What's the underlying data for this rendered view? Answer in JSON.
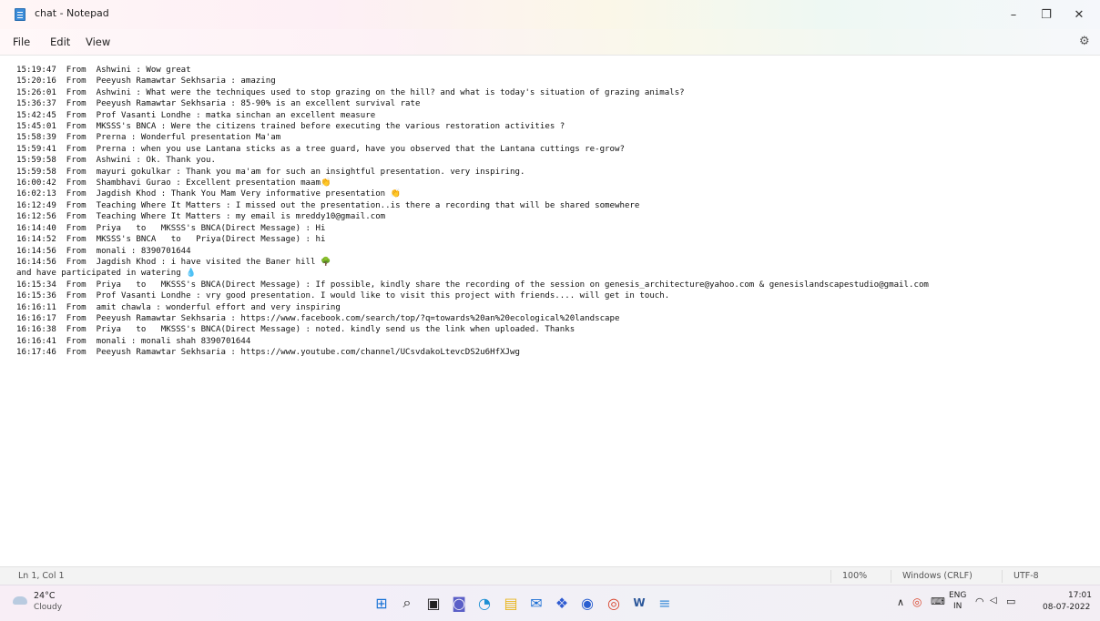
{
  "window": {
    "title": "chat - Notepad",
    "minimize_glyph": "–",
    "maximize_glyph": "❐",
    "close_glyph": "✕"
  },
  "menu": {
    "items": [
      "File",
      "Edit",
      "View"
    ],
    "settings_glyph": "⚙"
  },
  "document": {
    "lines": [
      "15:19:47\tFrom  Ashwini : Wow great",
      "15:20:16\tFrom  Peeyush Ramawtar Sekhsaria : amazing",
      "15:26:01\tFrom  Ashwini : What were the techniques used to stop grazing on the hill? and what is today's situation of grazing animals?",
      "15:36:37\tFrom  Peeyush Ramawtar Sekhsaria : 85-90% is an excellent survival rate",
      "15:42:45\tFrom  Prof Vasanti Londhe : matka sinchan an excellent measure",
      "15:45:01\tFrom  MKSSS's BNCA : Were the citizens trained before executing the various restoration activities ?",
      "15:58:39\tFrom  Prerna : Wonderful presentation Ma'am",
      "15:59:41\tFrom  Prerna : when you use Lantana sticks as a tree guard, have you observed that the Lantana cuttings re-grow?",
      "15:59:58\tFrom  Ashwini : Ok. Thank you.",
      "15:59:58\tFrom  mayuri gokulkar : Thank you ma'am for such an insightful presentation. very inspiring.",
      "16:00:42\tFrom  Shambhavi Gurao : Excellent presentation maam👏",
      "16:02:13\tFrom  Jagdish Khod : Thank You Mam Very informative presentation 👏",
      "16:12:49\tFrom  Teaching Where It Matters : I missed out the presentation..is there a recording that will be shared somewhere",
      "16:12:56\tFrom  Teaching Where It Matters : my email is mreddy10@gmail.com",
      "16:14:40\tFrom  Priya   to   MKSSS's BNCA(Direct Message) : Hi",
      "16:14:52\tFrom  MKSSS's BNCA   to   Priya(Direct Message) : hi",
      "16:14:56\tFrom  monali : 8390701644",
      "16:14:56\tFrom  Jagdish Khod : i have visited the Baner hill 🌳",
      "and have participated in watering 💧",
      "16:15:34\tFrom  Priya   to   MKSSS's BNCA(Direct Message) : If possible, kindly share the recording of the session on genesis_architecture@yahoo.com & genesislandscapestudio@gmail.com",
      "16:15:36\tFrom  Prof Vasanti Londhe : vry good presentation. I would like to visit this project with friends.... will get in touch.",
      "16:16:11\tFrom  amit chawla : wonderful effort and very inspiring",
      "16:16:17\tFrom  Peeyush Ramawtar Sekhsaria : https://www.facebook.com/search/top/?q=towards%20an%20ecological%20landscape",
      "16:16:38\tFrom  Priya   to   MKSSS's BNCA(Direct Message) : noted. kindly send us the link when uploaded. Thanks",
      "16:16:41\tFrom  monali : monali shah 8390701644",
      "16:17:46\tFrom  Peeyush Ramawtar Sekhsaria : https://www.youtube.com/channel/UCsvdakoLtevcDS2u6HfXJwg"
    ]
  },
  "status_bar": {
    "position": "Ln 1, Col 1",
    "zoom": "100%",
    "line_ending": "Windows (CRLF)",
    "encoding": "UTF-8"
  },
  "taskbar": {
    "weather": {
      "temp": "24°C",
      "condition": "Cloudy"
    },
    "icons": [
      {
        "name": "start-icon",
        "glyph": "⊞",
        "color": "#1a73d6"
      },
      {
        "name": "search-icon",
        "glyph": "⌕",
        "color": "#222222"
      },
      {
        "name": "task-view-icon",
        "glyph": "▣",
        "color": "#222222"
      },
      {
        "name": "chat-icon",
        "glyph": "◙",
        "color": "#5b5fc7"
      },
      {
        "name": "edge-icon",
        "glyph": "◔",
        "color": "#1c8fd4"
      },
      {
        "name": "file-explorer-icon",
        "glyph": "▤",
        "color": "#e8b51e"
      },
      {
        "name": "mail-icon",
        "glyph": "✉",
        "color": "#1c6fd4"
      },
      {
        "name": "dropbox-icon",
        "glyph": "❖",
        "color": "#2f5bd1"
      },
      {
        "name": "webex-icon",
        "glyph": "◉",
        "color": "#2a5fd0"
      },
      {
        "name": "chrome-icon",
        "glyph": "◎",
        "color": "#d9462f"
      },
      {
        "name": "word-icon",
        "glyph": "W",
        "color": "#2b579a"
      },
      {
        "name": "notepad-icon",
        "glyph": "≡",
        "color": "#3a8bd8"
      }
    ],
    "tray": {
      "chevron_glyph": "∧",
      "lang_line1": "ENG",
      "lang_line2": "IN",
      "wifi_glyph": "◠",
      "volume_glyph": "◁",
      "battery_glyph": "▭",
      "time": "17:01",
      "date": "08-07-2022"
    }
  }
}
